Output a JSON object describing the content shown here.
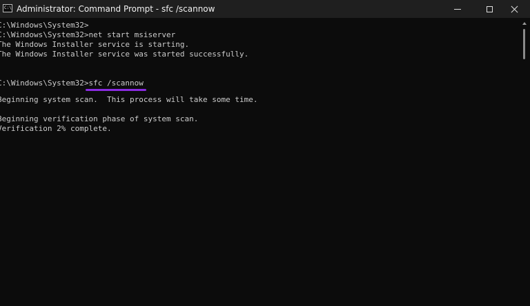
{
  "window": {
    "title": "Administrator: Command Prompt - sfc  /scannow",
    "app_icon_text": "C:\\"
  },
  "console": {
    "lines": [
      "C:\\Windows\\System32>",
      "C:\\Windows\\System32>net start msiserver",
      "The Windows Installer service is starting.",
      "The Windows Installer service was started successfully.",
      "",
      "",
      "C:\\Windows\\System32>",
      "",
      "Beginning system scan.  This process will take some time.",
      "",
      "Beginning verification phase of system scan.",
      "Verification 2% complete."
    ],
    "highlighted_command": "sfc /scannow"
  },
  "colors": {
    "background": "#0c0c0c",
    "text": "#cccccc",
    "titlebar": "#1f1f1f",
    "highlight_underline": "#8a2be2"
  }
}
